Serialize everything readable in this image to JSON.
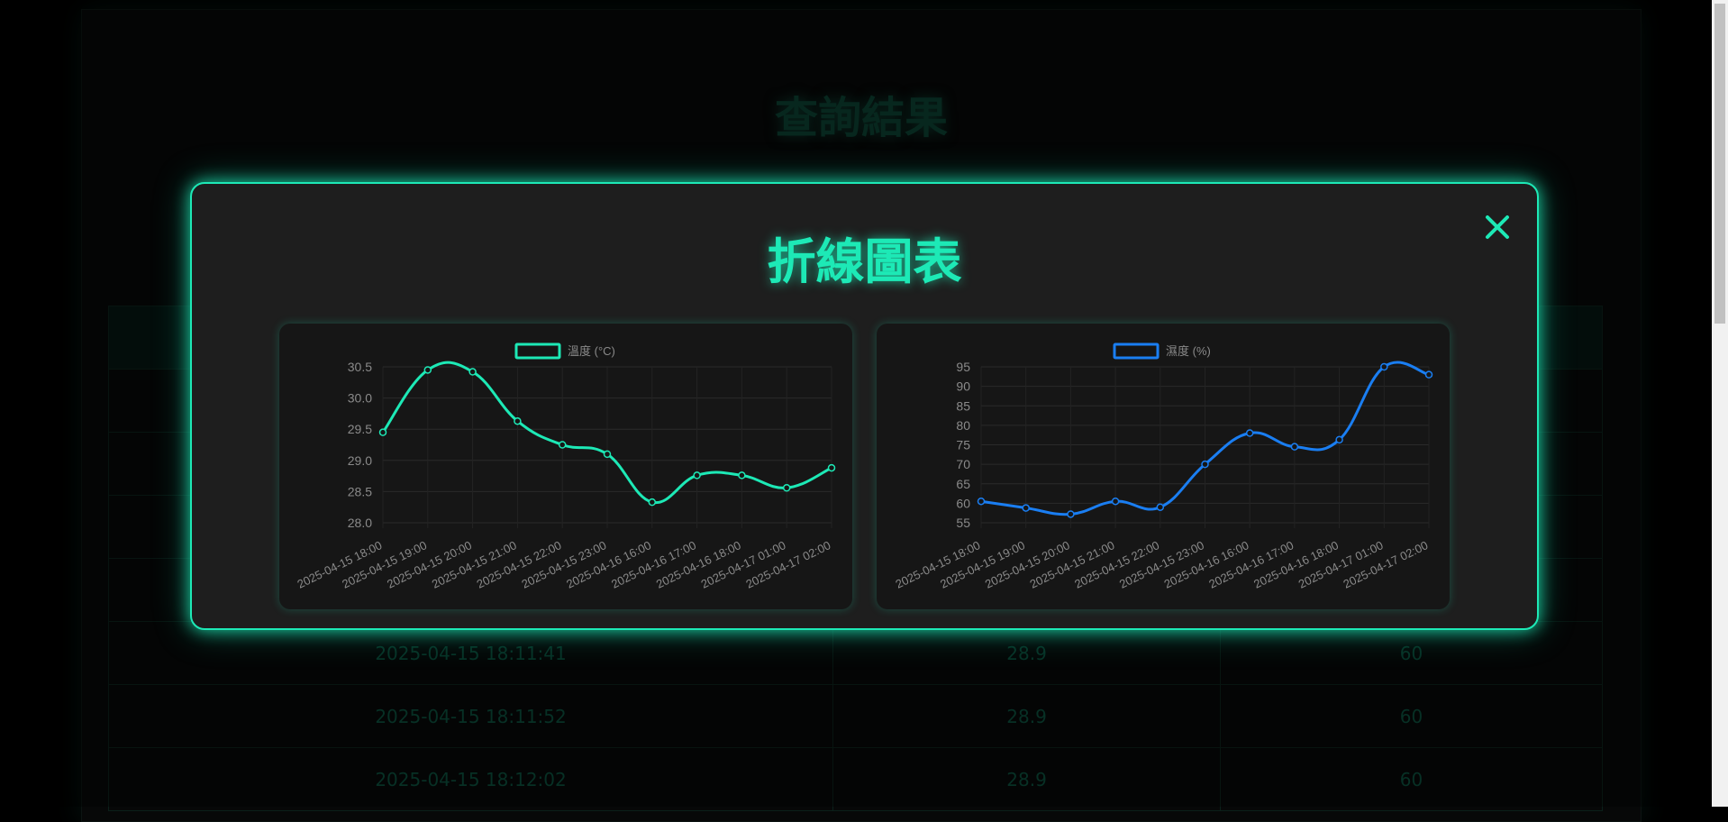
{
  "page": {
    "title": "查詢結果"
  },
  "table": {
    "rows": [
      {
        "time": "2025-04-15 18:11:41",
        "temp": "28.9",
        "hum": "60"
      },
      {
        "time": "2025-04-15 18:11:52",
        "temp": "28.9",
        "hum": "60"
      },
      {
        "time": "2025-04-15 18:12:02",
        "temp": "28.9",
        "hum": "60"
      }
    ]
  },
  "modal": {
    "title": "折線圖表",
    "close_icon": "close-icon"
  },
  "colors": {
    "accent": "#1de9b6",
    "humidity": "#1a7ef2"
  },
  "chart_data": [
    {
      "type": "line",
      "categories": [
        "2025-04-15 18:00",
        "2025-04-15 19:00",
        "2025-04-15 20:00",
        "2025-04-15 21:00",
        "2025-04-15 22:00",
        "2025-04-15 23:00",
        "2025-04-16 16:00",
        "2025-04-16 17:00",
        "2025-04-16 18:00",
        "2025-04-17 01:00",
        "2025-04-17 02:00"
      ],
      "series": [
        {
          "name": "溫度 (°C)",
          "values": [
            29.45,
            30.45,
            30.42,
            29.63,
            29.25,
            29.1,
            28.33,
            28.76,
            28.76,
            28.56,
            28.88
          ]
        }
      ],
      "ylim": [
        28.0,
        30.5
      ],
      "yticks": [
        "28.0",
        "28.5",
        "29.0",
        "29.5",
        "30.0",
        "30.5"
      ],
      "yticks_values": [
        28.0,
        28.5,
        29.0,
        29.5,
        30.0,
        30.5
      ],
      "legend": "top",
      "grid": true
    },
    {
      "type": "line",
      "categories": [
        "2025-04-15 18:00",
        "2025-04-15 19:00",
        "2025-04-15 20:00",
        "2025-04-15 21:00",
        "2025-04-15 22:00",
        "2025-04-15 23:00",
        "2025-04-16 16:00",
        "2025-04-16 17:00",
        "2025-04-16 18:00",
        "2025-04-17 01:00",
        "2025-04-17 02:00"
      ],
      "series": [
        {
          "name": "濕度 (%)",
          "values": [
            60.5,
            58.8,
            57.2,
            60.5,
            59,
            70,
            78,
            74.5,
            76.3,
            95,
            93
          ]
        }
      ],
      "ylim": [
        55,
        95
      ],
      "yticks": [
        "55",
        "60",
        "65",
        "70",
        "75",
        "80",
        "85",
        "90",
        "95"
      ],
      "yticks_values": [
        55,
        60,
        65,
        70,
        75,
        80,
        85,
        90,
        95
      ],
      "legend": "top",
      "grid": true
    }
  ]
}
